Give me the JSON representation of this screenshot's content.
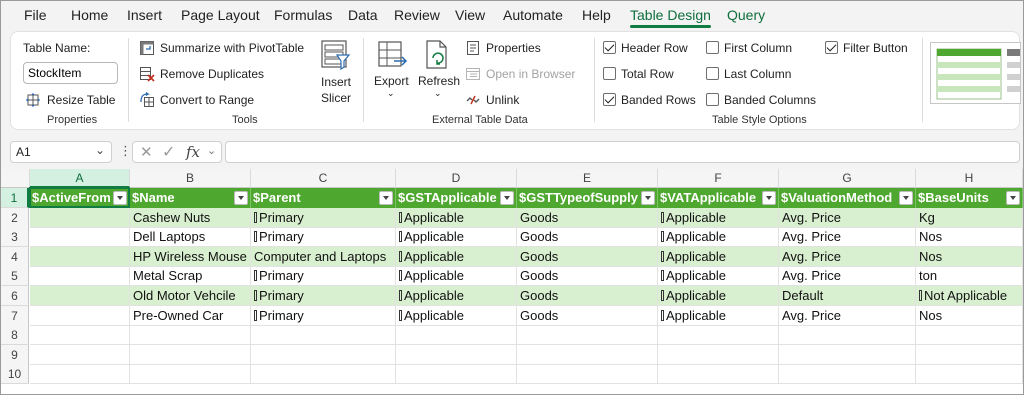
{
  "menu": {
    "tabs": [
      "File",
      "Home",
      "Insert",
      "Page Layout",
      "Formulas",
      "Data",
      "Review",
      "View",
      "Automate",
      "Help",
      "Table Design",
      "Query"
    ],
    "active_tab": "Table Design"
  },
  "ribbon": {
    "properties": {
      "table_name_label": "Table Name:",
      "table_name_value": "StockItem",
      "resize_label": "Resize Table",
      "group_name": "Properties"
    },
    "tools": {
      "summarize_label": "Summarize with PivotTable",
      "remove_dup_label": "Remove Duplicates",
      "convert_label": "Convert to Range",
      "insert_slicer_line1": "Insert",
      "insert_slicer_line2": "Slicer",
      "group_name": "Tools"
    },
    "external": {
      "export_label": "Export",
      "refresh_label": "Refresh",
      "properties_label": "Properties",
      "open_browser_label": "Open in Browser",
      "unlink_label": "Unlink",
      "group_name": "External Table Data"
    },
    "style_options": {
      "header_row": {
        "label": "Header Row",
        "checked": true
      },
      "total_row": {
        "label": "Total Row",
        "checked": false
      },
      "banded_rows": {
        "label": "Banded Rows",
        "checked": true
      },
      "first_column": {
        "label": "First Column",
        "checked": false
      },
      "last_column": {
        "label": "Last Column",
        "checked": false
      },
      "banded_columns": {
        "label": "Banded Columns",
        "checked": false
      },
      "filter_button": {
        "label": "Filter Button",
        "checked": true
      },
      "group_name": "Table Style Options"
    }
  },
  "formula_bar": {
    "name_box": "A1",
    "fx_label": "fx",
    "formula": ""
  },
  "sheet": {
    "columns": [
      "A",
      "B",
      "C",
      "D",
      "E",
      "F",
      "G",
      "H"
    ],
    "rows": [
      "1",
      "2",
      "3",
      "4",
      "5",
      "6",
      "7",
      "8",
      "9",
      "10"
    ],
    "headers": [
      "$ActiveFrom",
      "$Name",
      "$Parent",
      "$GSTApplicable",
      "$GSTTypeofSupply",
      "$VATApplicable",
      "$ValuationMethod",
      "$BaseUnits"
    ],
    "data": [
      [
        "",
        "Cashew Nuts",
        "Primary",
        "Applicable",
        "Goods",
        "Applicable",
        "Avg. Price",
        "Kg"
      ],
      [
        "",
        "Dell Laptops",
        "Primary",
        "Applicable",
        "Goods",
        "Applicable",
        "Avg. Price",
        "Nos"
      ],
      [
        "",
        "HP Wireless Mouse",
        "Computer and Laptops",
        "Applicable",
        "Goods",
        "Applicable",
        "Avg. Price",
        "Nos"
      ],
      [
        "",
        "Metal Scrap",
        "Primary",
        "Applicable",
        "Goods",
        "Applicable",
        "Avg. Price",
        "ton"
      ],
      [
        "",
        "Old Motor Vehcile",
        "Primary",
        "Applicable",
        "Goods",
        "Applicable",
        "Default",
        "Not Applicable"
      ],
      [
        "",
        "Pre-Owned Car",
        "Primary",
        "Applicable",
        "Goods",
        "Applicable",
        "Avg. Price",
        "Nos"
      ]
    ],
    "tick_cells": [
      [
        2,
        true
      ],
      [
        3,
        true
      ],
      [
        5,
        true
      ]
    ],
    "tick_special": {
      "4_7": true
    }
  },
  "colors": {
    "accent": "#107c41",
    "header_fill": "#4ea72e",
    "band_fill": "#d9f0d0"
  }
}
